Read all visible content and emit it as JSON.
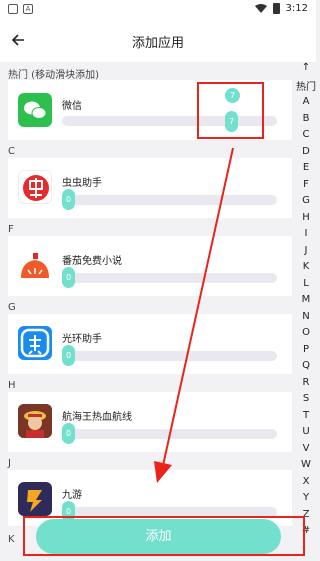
{
  "statusbar": {
    "time": "3:12",
    "icon_a": "A"
  },
  "header": {
    "title": "添加应用"
  },
  "hot_section": {
    "label": "热门 (移动滑块添加)"
  },
  "sections": {
    "c": "C",
    "f": "F",
    "g": "G",
    "h": "H",
    "j": "J",
    "k": "K"
  },
  "apps": [
    {
      "name": "微信",
      "value": "7",
      "preview_value": "7"
    },
    {
      "name": "虫虫助手",
      "value": "0"
    },
    {
      "name": "番茄免费小说",
      "value": "0"
    },
    {
      "name": "光环助手",
      "value": "0"
    },
    {
      "name": "航海王热血航线",
      "value": "0"
    },
    {
      "name": "九游",
      "value": "0"
    }
  ],
  "index": {
    "items": [
      "↑",
      "热门",
      "A",
      "B",
      "C",
      "D",
      "E",
      "F",
      "G",
      "H",
      "I",
      "J",
      "K",
      "L",
      "M",
      "N",
      "O",
      "P",
      "Q",
      "R",
      "S",
      "T",
      "U",
      "V",
      "W",
      "X",
      "Y",
      "Z",
      "#"
    ]
  },
  "add_button": {
    "label": "添加"
  },
  "icons": {
    "back": "arrow-left",
    "wechat": "wechat-logo",
    "chongchong": "chongchong-logo",
    "fanqie": "tomato-logo",
    "guanghuan": "guanghuan-logo",
    "onepiece": "game-art",
    "jiuyou": "jiuyou-logo"
  },
  "colors": {
    "accent": "#72e0cd",
    "annotation": "#e8241c"
  }
}
